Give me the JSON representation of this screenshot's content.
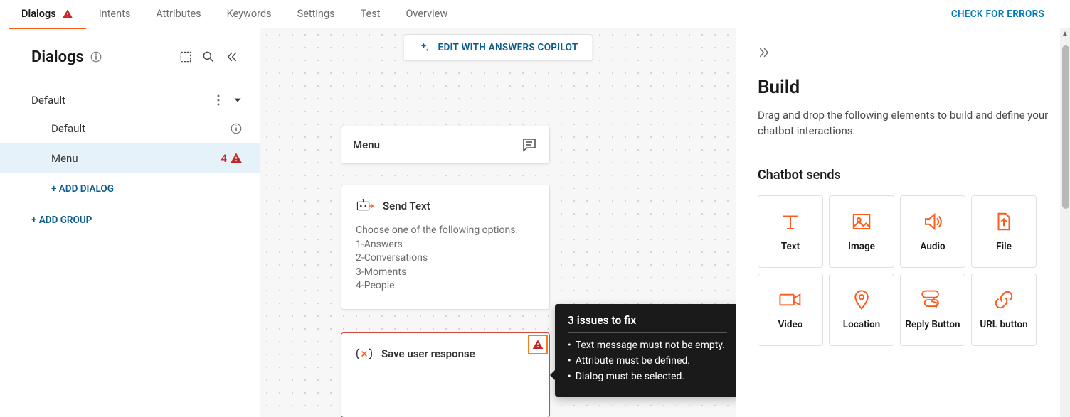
{
  "tabs": [
    "Dialogs",
    "Intents",
    "Attributes",
    "Keywords",
    "Settings",
    "Test",
    "Overview"
  ],
  "active_tab_index": 0,
  "check_errors": "CHECK FOR ERRORS",
  "sidebar": {
    "title": "Dialogs",
    "group_name": "Default",
    "items": [
      {
        "label": "Default",
        "has_info": true
      },
      {
        "label": "Menu",
        "badge_count": "4",
        "has_warning": true,
        "selected": true
      }
    ],
    "add_dialog": "+ ADD DIALOG",
    "add_group": "+ ADD GROUP"
  },
  "canvas": {
    "copilot_label": "EDIT WITH ANSWERS COPILOT",
    "menu_node": {
      "title": "Menu"
    },
    "send_node": {
      "title": "Send Text",
      "lines": [
        "Choose one of the following options.",
        "1-Answers",
        "2-Conversations",
        "3-Moments",
        "4-People"
      ]
    },
    "save_node": {
      "title": "Save user response"
    },
    "tooltip": {
      "title": "3 issues to fix",
      "items": [
        "Text message must not be empty.",
        "Attribute must be defined.",
        "Dialog must be selected."
      ]
    }
  },
  "right": {
    "title": "Build",
    "desc": "Drag and drop the following elements to build and define your chatbot interactions:",
    "section": "Chatbot sends",
    "tiles": [
      "Text",
      "Image",
      "Audio",
      "File",
      "Video",
      "Location",
      "Reply Button",
      "URL button"
    ]
  }
}
